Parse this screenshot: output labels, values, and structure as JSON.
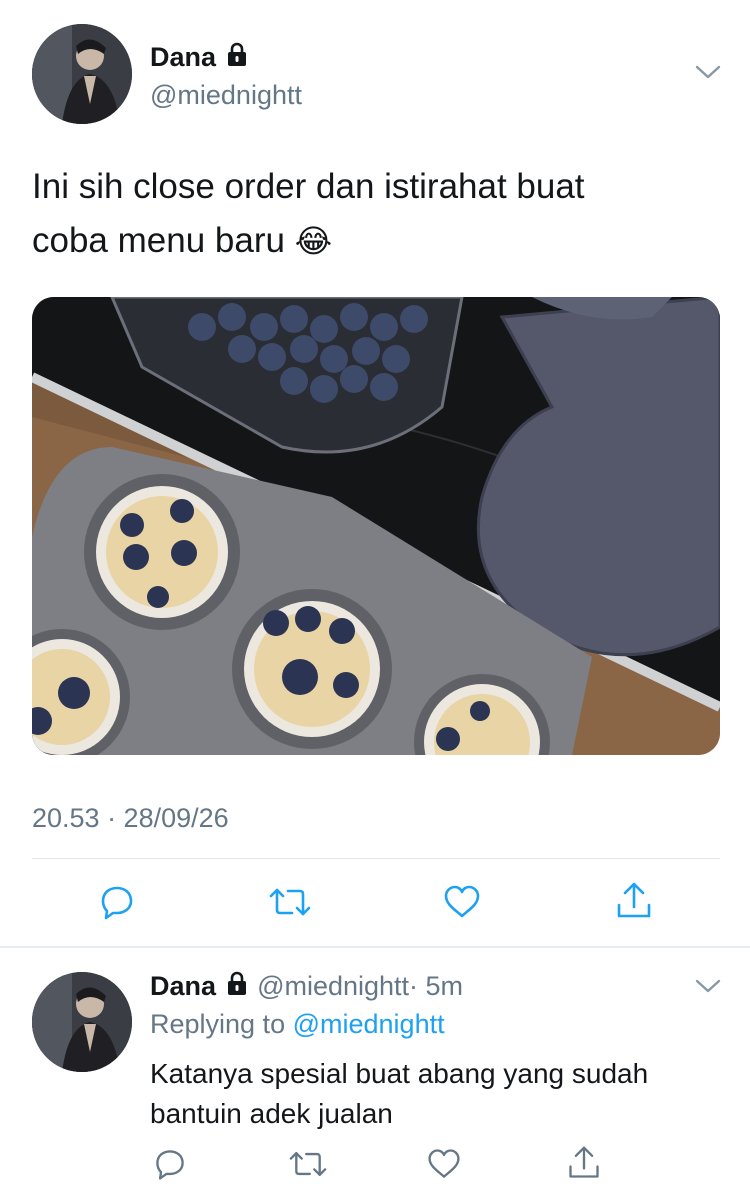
{
  "main_tweet": {
    "name": "Dana",
    "handle": "@miednightt",
    "text_line1": "Ini sih close order dan istirahat buat",
    "text_line2": "coba menu baru",
    "emoji": "😂",
    "timestamp": "20.53 · 28/09/26",
    "image_icon": "blueberry-muffin-photo"
  },
  "reply_tweet": {
    "name": "Dana",
    "handle": "@miednightt",
    "time": "· 5m",
    "replying_label": "Replying to",
    "replying_handle": "@miednightt",
    "text_line1": "Katanya spesial buat abang yang sudah",
    "text_line2": "bantuin adek jualan"
  },
  "icons": [
    "lock-icon",
    "chevron-down-icon",
    "reply-icon",
    "retweet-icon",
    "like-icon",
    "share-icon"
  ],
  "colors": {
    "accent": "#1da1f2",
    "muted": "#657786",
    "icon": "#1da1f2"
  }
}
